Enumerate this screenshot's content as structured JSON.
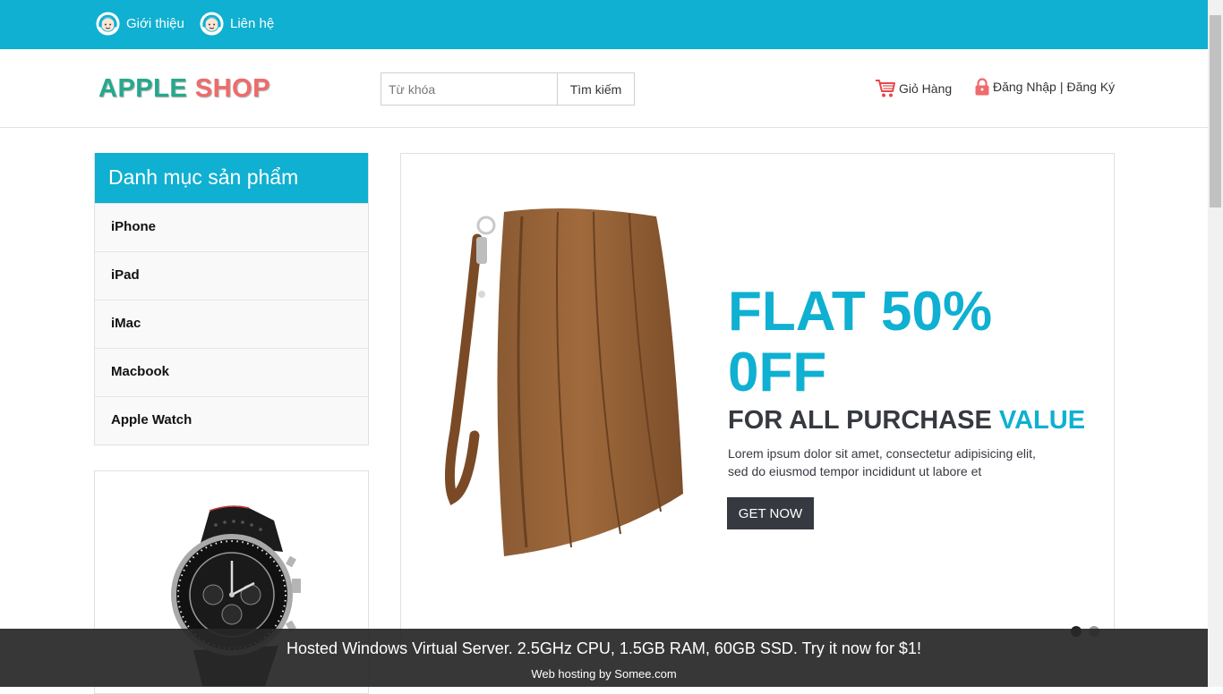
{
  "topbar": {
    "links": [
      {
        "label": "Giới thiệu",
        "icon": "support-headset-icon"
      },
      {
        "label": "Liên hệ",
        "icon": "support-headset-icon"
      }
    ],
    "color": "#0fb0d1"
  },
  "header": {
    "logo": {
      "part1": "APPLE",
      "part2": "SHOP"
    },
    "search": {
      "placeholder": "Từ khóa",
      "button_label": "Tìm kiếm"
    },
    "cart_label": "Giỏ Hàng",
    "login_label": "Đăng Nhập",
    "separator": "|",
    "register_label": "Đăng Ký"
  },
  "sidebar": {
    "title": "Danh mục sản phẩm",
    "items": [
      "iPhone",
      "iPad",
      "iMac",
      "Macbook",
      "Apple Watch"
    ]
  },
  "banner": {
    "headline": "FLAT 50% 0FF",
    "sub_prefix": "FOR ALL PURCHASE",
    "sub_highlight": "VALUE",
    "body_line1": "Lorem ipsum dolor sit amet, consectetur adipisicing elit,",
    "body_line2": "sed do eiusmod tempor incididunt ut labore et",
    "cta_label": "GET NOW",
    "image": "brown-leather-bag",
    "slides_total": 2,
    "active_slide": 1
  },
  "sidebar_product_image": "wristwatch",
  "hosting_bar": {
    "ad": "Hosted Windows Virtual Server. 2.5GHz CPU, 1.5GB RAM, 60GB SSD. Try it now for $1!",
    "by": "Web hosting by Somee.com"
  },
  "colors": {
    "accent": "#0fb0d1",
    "dark": "#363940",
    "logo_green": "#23a98d",
    "logo_red": "#ef6b6b"
  }
}
